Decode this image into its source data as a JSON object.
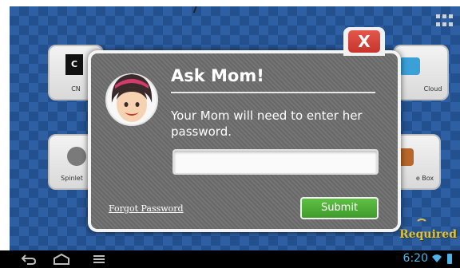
{
  "apps": [
    {
      "label": "CN",
      "logo_text": "C",
      "icon": "cartoon-network-icon"
    },
    {
      "label": "Cloud",
      "icon": "cloud-app-icon"
    },
    {
      "label": "Spinlet",
      "icon": "spinlet-icon"
    },
    {
      "label": "e Box",
      "icon": "box-app-icon"
    }
  ],
  "dialog": {
    "title": "Ask Mom!",
    "message": "Your Mom will need to enter her password.",
    "password_value": "",
    "close_label": "X",
    "forgot_label": "Forgot Password",
    "submit_label": "Submit",
    "avatar_icon": "mom-avatar-icon"
  },
  "badge": {
    "label": "Required"
  },
  "status": {
    "time": "6:20"
  },
  "nav": {
    "back_icon": "back-icon",
    "home_icon": "home-icon",
    "recent_icon": "recent-apps-icon"
  },
  "colors": {
    "background": "#2f5fa3",
    "dialog": "#6e6e6e",
    "close_red": "#d9443a",
    "submit_green": "#4caf35",
    "status_blue": "#4fb3e8"
  }
}
